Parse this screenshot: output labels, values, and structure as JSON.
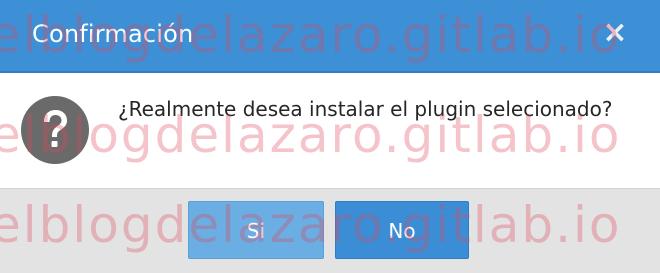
{
  "dialog": {
    "title": "Confirmación",
    "close_label": "×",
    "message": "¿Realmente desea instalar el plugin selecionado?",
    "icon": "question-icon",
    "buttons": {
      "yes_label": "Si",
      "no_label": "No"
    }
  },
  "watermark": {
    "text": "elblogdelazaro.gitlab.io"
  },
  "colors": {
    "titlebar": "#3d8fd6",
    "button_yes": "#6aaee3",
    "button_no": "#3b8ed6",
    "footer": "#e3e3e3",
    "icon": "#6a6a6a"
  }
}
